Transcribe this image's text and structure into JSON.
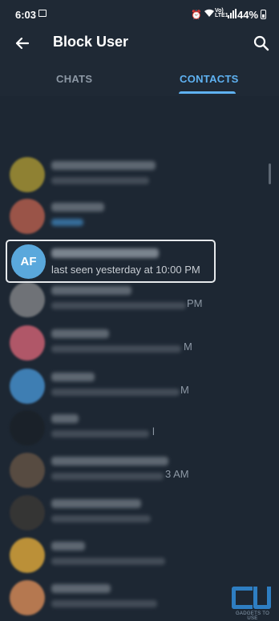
{
  "status_bar": {
    "time": "6:03",
    "volte_top": "Vo)",
    "volte_bottom": "LTE1",
    "battery": "44%"
  },
  "app_bar": {
    "title": "Block User",
    "icons": [
      "back-arrow-icon",
      "search-icon"
    ]
  },
  "tabs": [
    {
      "label": "CHATS",
      "selected": false
    },
    {
      "label": "CONTACTS",
      "selected": true
    }
  ],
  "colors": {
    "background": "#1d2733",
    "toolbar": "#1f2935",
    "accent": "#5fb2f2",
    "highlight_border": "#e6e9ec"
  },
  "contacts": [
    {
      "avatar": "photo",
      "name": "blurred",
      "status": "blurred"
    },
    {
      "avatar": "photo",
      "name": "blurred",
      "status": "blurred"
    },
    {
      "avatar_initials": "AF",
      "avatar_color": "#5aa8dc",
      "name": "blurred",
      "status": "last seen yesterday at 10:00 PM",
      "highlighted": true
    },
    {
      "avatar": "photo",
      "name": "blurred",
      "status": "blurred",
      "status_tail": "PM"
    },
    {
      "avatar": "initials-blurred",
      "name": "blurred",
      "status": "blurred",
      "status_tail": "M"
    },
    {
      "avatar": "initials-blurred",
      "name": "blurred",
      "status": "blurred",
      "status_tail": "M"
    },
    {
      "avatar": "photo",
      "name": "blurred",
      "status": "blurred",
      "status_tail": "l"
    },
    {
      "avatar": "photo",
      "name": "blurred",
      "status": "blurred",
      "status_tail": "3 AM"
    },
    {
      "avatar": "photo",
      "name": "blurred",
      "status": "blurred"
    },
    {
      "avatar": "emoji",
      "name": "blurred",
      "status": "blurred"
    },
    {
      "avatar": "photo",
      "name": "blurred",
      "status": "blurred"
    }
  ],
  "watermark": {
    "text": "GADGETS TO USE"
  }
}
